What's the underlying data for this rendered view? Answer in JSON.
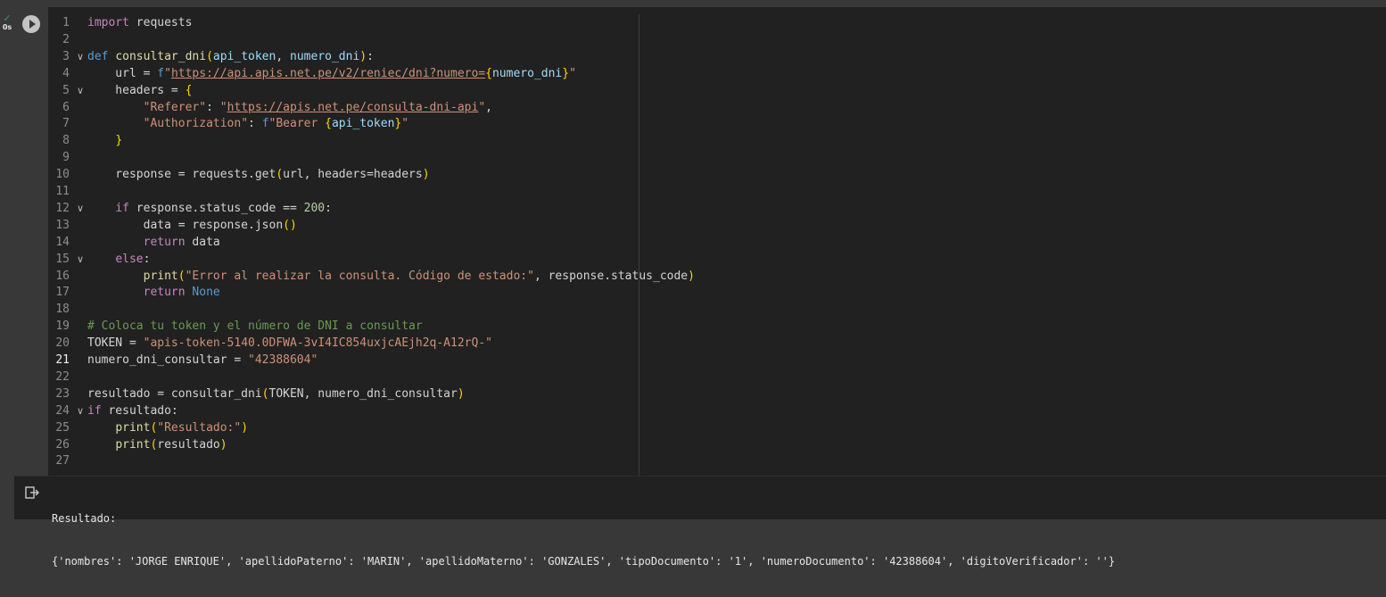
{
  "execution": {
    "status_icon": "check-icon",
    "duration": "0s"
  },
  "code_lines": [
    {
      "num": "1",
      "foldable": false,
      "tokens": [
        {
          "c": "ctl",
          "t": "import"
        },
        {
          "c": "",
          "t": " requests"
        }
      ]
    },
    {
      "num": "2",
      "foldable": false,
      "tokens": []
    },
    {
      "num": "3",
      "foldable": true,
      "tokens": [
        {
          "c": "kw",
          "t": "def"
        },
        {
          "c": "",
          "t": " "
        },
        {
          "c": "fn",
          "t": "consultar_dni"
        },
        {
          "c": "br1",
          "t": "("
        },
        {
          "c": "prm",
          "t": "api_token"
        },
        {
          "c": "",
          "t": ", "
        },
        {
          "c": "prm",
          "t": "numero_dni"
        },
        {
          "c": "br1",
          "t": ")"
        },
        {
          "c": "",
          "t": ":"
        }
      ]
    },
    {
      "num": "4",
      "foldable": false,
      "tokens": [
        {
          "c": "",
          "t": "    url = "
        },
        {
          "c": "kw",
          "t": "f"
        },
        {
          "c": "str",
          "t": "\""
        },
        {
          "c": "lnk",
          "t": "https://api.apis.net.pe/v2/reniec/dni?numero="
        },
        {
          "c": "br1",
          "t": "{"
        },
        {
          "c": "ib",
          "t": "numero_dni"
        },
        {
          "c": "br1",
          "t": "}"
        },
        {
          "c": "str",
          "t": "\""
        }
      ]
    },
    {
      "num": "5",
      "foldable": true,
      "tokens": [
        {
          "c": "",
          "t": "    headers = "
        },
        {
          "c": "br1",
          "t": "{"
        }
      ]
    },
    {
      "num": "6",
      "foldable": false,
      "tokens": [
        {
          "c": "",
          "t": "        "
        },
        {
          "c": "str",
          "t": "\"Referer\""
        },
        {
          "c": "",
          "t": ": "
        },
        {
          "c": "str",
          "t": "\""
        },
        {
          "c": "lnk",
          "t": "https://apis.net.pe/consulta-dni-api"
        },
        {
          "c": "str",
          "t": "\""
        },
        {
          "c": "",
          "t": ","
        }
      ]
    },
    {
      "num": "7",
      "foldable": false,
      "tokens": [
        {
          "c": "",
          "t": "        "
        },
        {
          "c": "str",
          "t": "\"Authorization\""
        },
        {
          "c": "",
          "t": ": "
        },
        {
          "c": "kw",
          "t": "f"
        },
        {
          "c": "str",
          "t": "\"Bearer "
        },
        {
          "c": "br1",
          "t": "{"
        },
        {
          "c": "ib",
          "t": "api_token"
        },
        {
          "c": "br1",
          "t": "}"
        },
        {
          "c": "str",
          "t": "\""
        }
      ]
    },
    {
      "num": "8",
      "foldable": false,
      "tokens": [
        {
          "c": "",
          "t": "    "
        },
        {
          "c": "br1",
          "t": "}"
        }
      ]
    },
    {
      "num": "9",
      "foldable": false,
      "tokens": []
    },
    {
      "num": "10",
      "foldable": false,
      "tokens": [
        {
          "c": "",
          "t": "    response = requests.get"
        },
        {
          "c": "br1",
          "t": "("
        },
        {
          "c": "",
          "t": "url, headers=headers"
        },
        {
          "c": "br1",
          "t": ")"
        }
      ]
    },
    {
      "num": "11",
      "foldable": false,
      "tokens": []
    },
    {
      "num": "12",
      "foldable": true,
      "tokens": [
        {
          "c": "",
          "t": "    "
        },
        {
          "c": "ctl",
          "t": "if"
        },
        {
          "c": "",
          "t": " response.status_code == "
        },
        {
          "c": "num",
          "t": "200"
        },
        {
          "c": "",
          "t": ":"
        }
      ]
    },
    {
      "num": "13",
      "foldable": false,
      "tokens": [
        {
          "c": "",
          "t": "        data = response.json"
        },
        {
          "c": "br1",
          "t": "()"
        }
      ]
    },
    {
      "num": "14",
      "foldable": false,
      "tokens": [
        {
          "c": "",
          "t": "        "
        },
        {
          "c": "ctl",
          "t": "return"
        },
        {
          "c": "",
          "t": " data"
        }
      ]
    },
    {
      "num": "15",
      "foldable": true,
      "tokens": [
        {
          "c": "",
          "t": "    "
        },
        {
          "c": "ctl",
          "t": "else"
        },
        {
          "c": "",
          "t": ":"
        }
      ]
    },
    {
      "num": "16",
      "foldable": false,
      "tokens": [
        {
          "c": "",
          "t": "        "
        },
        {
          "c": "fn",
          "t": "print"
        },
        {
          "c": "br1",
          "t": "("
        },
        {
          "c": "str",
          "t": "\"Error al realizar la consulta. Código de estado:\""
        },
        {
          "c": "",
          "t": ", response.status_code"
        },
        {
          "c": "br1",
          "t": ")"
        }
      ]
    },
    {
      "num": "17",
      "foldable": false,
      "tokens": [
        {
          "c": "",
          "t": "        "
        },
        {
          "c": "ctl",
          "t": "return"
        },
        {
          "c": "",
          "t": " "
        },
        {
          "c": "kw",
          "t": "None"
        }
      ]
    },
    {
      "num": "18",
      "foldable": false,
      "tokens": []
    },
    {
      "num": "19",
      "foldable": false,
      "tokens": [
        {
          "c": "com",
          "t": "# Coloca tu token y el número de DNI a consultar"
        }
      ]
    },
    {
      "num": "20",
      "foldable": false,
      "tokens": [
        {
          "c": "",
          "t": "TOKEN = "
        },
        {
          "c": "str",
          "t": "\"apis-token-5140.0DFWA-3vI4IC854uxjcAEjh2q-A12rQ-\""
        }
      ]
    },
    {
      "num": "21",
      "foldable": false,
      "active": true,
      "tokens": [
        {
          "c": "",
          "t": "numero_dni_consultar = "
        },
        {
          "c": "str",
          "t": "\"42388604\""
        }
      ]
    },
    {
      "num": "22",
      "foldable": false,
      "tokens": []
    },
    {
      "num": "23",
      "foldable": false,
      "tokens": [
        {
          "c": "",
          "t": "resultado = consultar_dni"
        },
        {
          "c": "br1",
          "t": "("
        },
        {
          "c": "",
          "t": "TOKEN, numero_dni_consultar"
        },
        {
          "c": "br1",
          "t": ")"
        }
      ]
    },
    {
      "num": "24",
      "foldable": true,
      "tokens": [
        {
          "c": "ctl",
          "t": "if"
        },
        {
          "c": "",
          "t": " resultado:"
        }
      ]
    },
    {
      "num": "25",
      "foldable": false,
      "tokens": [
        {
          "c": "",
          "t": "    "
        },
        {
          "c": "fn",
          "t": "print"
        },
        {
          "c": "br1",
          "t": "("
        },
        {
          "c": "str",
          "t": "\"Resultado:\""
        },
        {
          "c": "br1",
          "t": ")"
        }
      ]
    },
    {
      "num": "26",
      "foldable": false,
      "tokens": [
        {
          "c": "",
          "t": "    "
        },
        {
          "c": "fn",
          "t": "print"
        },
        {
          "c": "br1",
          "t": "("
        },
        {
          "c": "",
          "t": "resultado"
        },
        {
          "c": "br1",
          "t": ")"
        }
      ]
    },
    {
      "num": "27",
      "foldable": false,
      "tokens": []
    }
  ],
  "output": {
    "icon": "output-redirect-icon",
    "lines": [
      "Resultado:",
      "{'nombres': 'JORGE ENRIQUE', 'apellidoPaterno': 'MARIN', 'apellidoMaterno': 'GONZALES', 'tipoDocumento': '1', 'numeroDocumento': '42388604', 'digitoVerificador': ''}"
    ]
  },
  "colors": {
    "background": "#383838",
    "cell": "#212121",
    "keyword": "#569cd6",
    "control": "#c586c0",
    "function": "#dcdcaa",
    "string": "#ce9178",
    "number": "#b5cea8",
    "comment": "#6a9955",
    "bracket": "#ffd700",
    "success": "#2e9c5a"
  }
}
